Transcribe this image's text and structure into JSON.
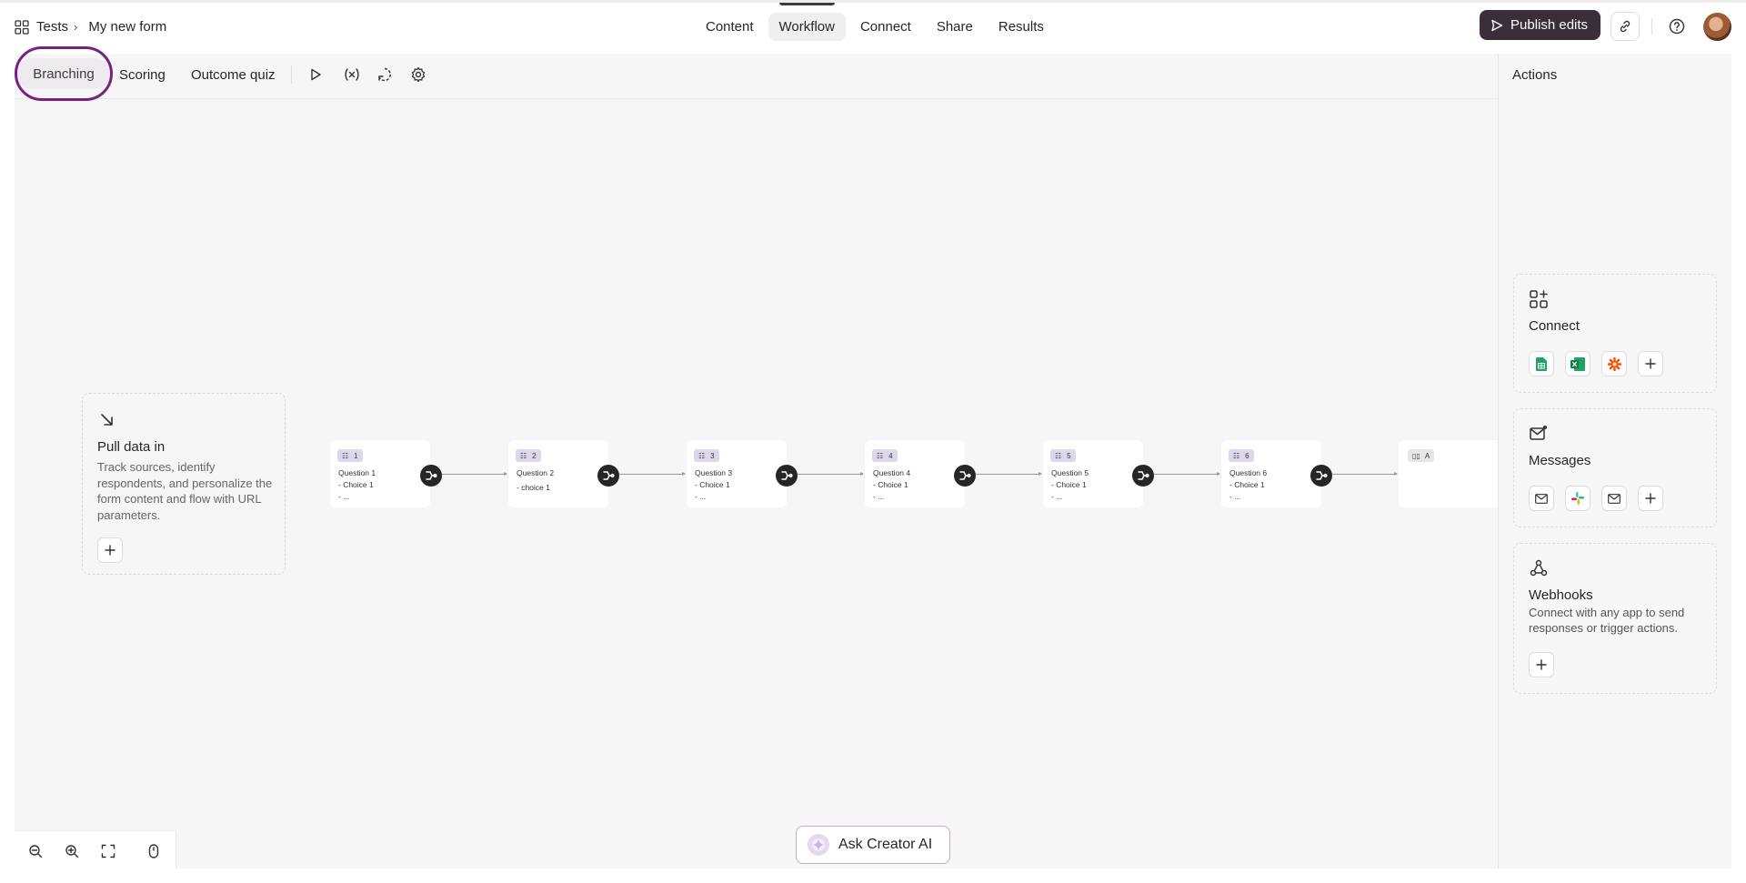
{
  "breadcrumb": {
    "parent": "Tests",
    "separator": "›",
    "current": "My new form"
  },
  "nav": {
    "tabs": [
      {
        "label": "Content"
      },
      {
        "label": "Workflow",
        "active": true
      },
      {
        "label": "Connect"
      },
      {
        "label": "Share"
      },
      {
        "label": "Results"
      }
    ]
  },
  "header": {
    "publish_label": "Publish edits"
  },
  "toolbar": {
    "tabs": [
      "Branching",
      "Scoring",
      "Outcome quiz"
    ]
  },
  "pull_card": {
    "title": "Pull data in",
    "description": "Track sources, identify respondents, and personalize the form content and flow with URL parameters."
  },
  "flow": {
    "nodes": [
      {
        "number": "1",
        "title": "Question 1",
        "lines": [
          "- Choice 1",
          "- ..."
        ]
      },
      {
        "number": "2",
        "title": "Question 2",
        "lines": [
          "- choice 1"
        ]
      },
      {
        "number": "3",
        "title": "Question 3",
        "lines": [
          "- Choice 1",
          "- ..."
        ]
      },
      {
        "number": "4",
        "title": "Question 4",
        "lines": [
          "- Choice 1",
          "- ..."
        ]
      },
      {
        "number": "5",
        "title": "Question 5",
        "lines": [
          "- Choice 1",
          "- ..."
        ]
      },
      {
        "number": "6",
        "title": "Question 6",
        "lines": [
          "- Choice 1",
          "- ..."
        ]
      }
    ],
    "end_badge": "A"
  },
  "actions": {
    "title": "Actions",
    "connect": {
      "title": "Connect",
      "apps": [
        "google-sheets-icon",
        "excel-icon",
        "zapier-icon"
      ]
    },
    "messages": {
      "title": "Messages",
      "apps": [
        "email-icon",
        "slack-icon",
        "email-icon"
      ]
    },
    "webhooks": {
      "title": "Webhooks",
      "description": "Connect with any app to send responses or trigger actions."
    }
  },
  "ask_ai": {
    "label": "Ask Creator AI"
  },
  "colors": {
    "accent": "#7a1f83",
    "publish_bg": "#3a2e38",
    "canvas_bg": "#f6f6f6"
  }
}
